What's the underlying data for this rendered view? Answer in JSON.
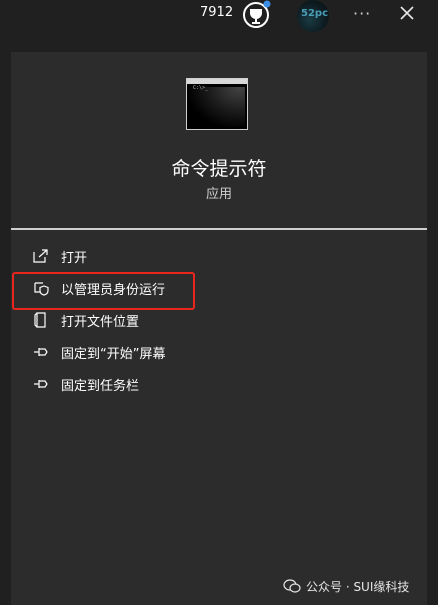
{
  "topbar": {
    "points": "7912",
    "avatar_text": "52pc"
  },
  "app": {
    "name": "命令提示符",
    "type": "应用",
    "thumb_text": "C:\\>_"
  },
  "menu": {
    "items": [
      {
        "label": "打开",
        "icon": "open-window-icon"
      },
      {
        "label": "以管理员身份运行",
        "icon": "shield-icon"
      },
      {
        "label": "打开文件位置",
        "icon": "document-icon"
      },
      {
        "label": "固定到“开始”屏幕",
        "icon": "pin-icon"
      },
      {
        "label": "固定到任务栏",
        "icon": "pin-icon"
      }
    ]
  },
  "highlight_color": "#e8261e",
  "watermark": {
    "text": "公众号 · SUI缘科技"
  }
}
